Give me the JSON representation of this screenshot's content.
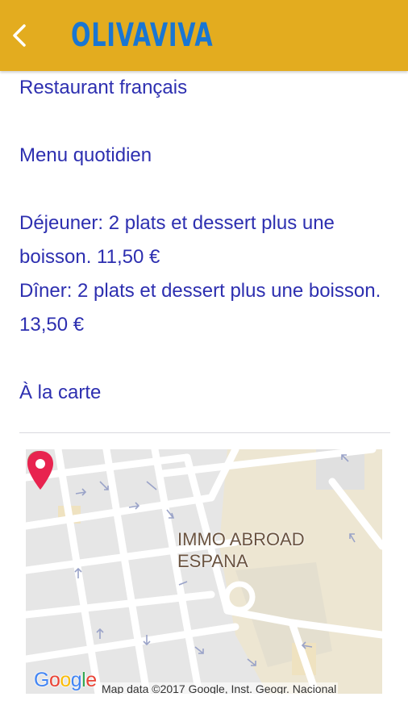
{
  "header": {
    "back_icon": "chevron-left-icon",
    "title": "OLIVAVIVA",
    "bg_color": "#e3ac1f",
    "title_color": "#1976d2"
  },
  "content": {
    "text_color": "#2d2fb0",
    "heading": "Restaurant français",
    "menu": "Menu quotidien",
    "lunch_1": "Déjeuner: 2 plats et dessert plus une",
    "lunch_2": "boisson. 11,50 €",
    "dinner_1": "Dîner: 2 plats et dessert plus une boisson.",
    "dinner_2": "13,50 €",
    "carte": "À la carte"
  },
  "map": {
    "poi_label_1": "IMMO ABROAD",
    "poi_label_2": "ESPANA",
    "google_logo": "Google",
    "attribution": "Map data ©2017 Google, Inst. Geogr. Nacional",
    "pin_color": "#e8234f",
    "pin_icon": "map-pin-icon",
    "poi_icon": "place-circle-icon"
  }
}
